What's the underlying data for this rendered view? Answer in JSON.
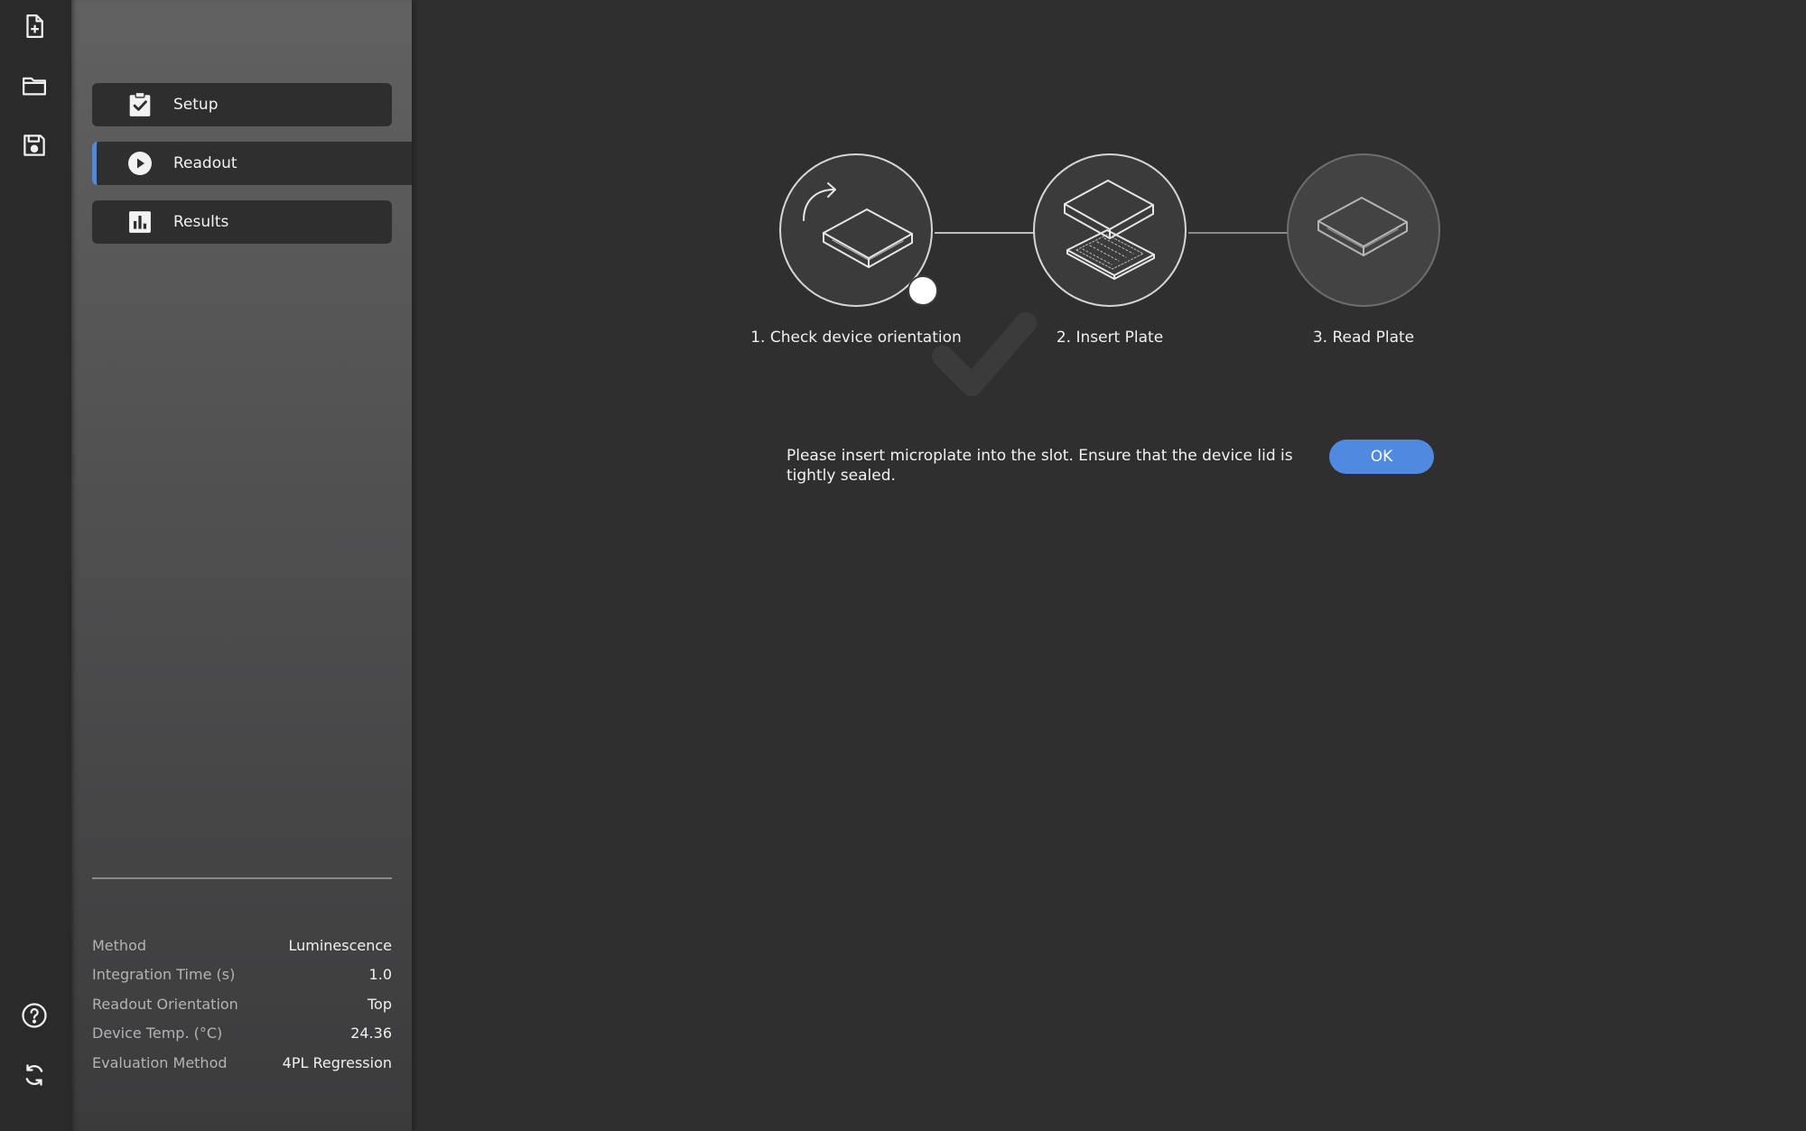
{
  "rail": {
    "top_icons": [
      "new-file-icon",
      "open-folder-icon",
      "save-icon"
    ],
    "bottom_icons": [
      "help-icon",
      "sync-icon"
    ]
  },
  "nav": {
    "items": [
      {
        "label": "Setup",
        "icon": "clipboard-check-icon",
        "active": false
      },
      {
        "label": "Readout",
        "icon": "play-circle-icon",
        "active": true
      },
      {
        "label": "Results",
        "icon": "bar-chart-icon",
        "active": false
      }
    ]
  },
  "info": {
    "rows": [
      {
        "label": "Method",
        "value": "Luminescence"
      },
      {
        "label": "Integration Time (s)",
        "value": "1.0"
      },
      {
        "label": "Readout Orientation",
        "value": "Top"
      },
      {
        "label": "Device Temp. (°C)",
        "value": "24.36"
      },
      {
        "label": "Evaluation Method",
        "value": "4PL Regression"
      }
    ]
  },
  "steps": [
    {
      "label": "1. Check device orientation",
      "status": "done",
      "icon": "rotate-device-icon"
    },
    {
      "label": "2. Insert Plate",
      "status": "current",
      "icon": "insert-plate-icon"
    },
    {
      "label": "3. Read Plate",
      "status": "pending",
      "icon": "read-plate-icon"
    }
  ],
  "message": {
    "text": "Please insert microplate into the slot. Ensure that the device lid is tightly sealed.",
    "ok_label": "OK"
  },
  "colors": {
    "accent": "#4f8ae0",
    "background": "#2f2f30",
    "panel": "#555556"
  }
}
